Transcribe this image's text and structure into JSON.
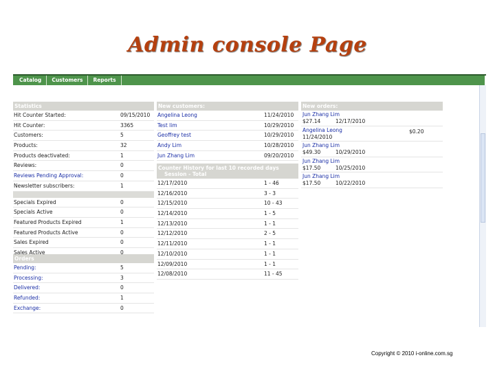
{
  "title": "Admin console Page",
  "copyright": "Copyright © 2010  i-online.com.sg",
  "nav": [
    "Catalog",
    "Customers",
    "Reports"
  ],
  "statistics": {
    "header": "Statistics",
    "rows": [
      {
        "label": "Hit Counter Started:",
        "value": "09/15/2010",
        "link": false
      },
      {
        "label": "Hit Counter:",
        "value": "3365",
        "link": false
      },
      {
        "label": "Customers:",
        "value": "5",
        "link": false
      },
      {
        "label": "Products:",
        "value": "32",
        "link": false
      },
      {
        "label": "Products deactivated:",
        "value": "1",
        "link": false
      },
      {
        "label": "Reviews:",
        "value": "0",
        "link": false
      },
      {
        "label": "Reviews Pending Approval:",
        "value": "0",
        "link": true
      },
      {
        "label": "Newsletter subscribers:",
        "value": "1",
        "link": false
      }
    ],
    "specials": [
      {
        "label": "Specials Expired",
        "value": "0"
      },
      {
        "label": "Specials Active",
        "value": "0"
      },
      {
        "label": "Featured Products Expired",
        "value": "1"
      },
      {
        "label": "Featured Products Active",
        "value": "0"
      },
      {
        "label": "Sales Expired",
        "value": "0"
      },
      {
        "label": "Sales Active",
        "value": "0"
      }
    ]
  },
  "orders": {
    "header": "Orders",
    "rows": [
      {
        "label": "Pending:",
        "value": "5"
      },
      {
        "label": "Processing:",
        "value": "3"
      },
      {
        "label": "Delivered:",
        "value": "0"
      },
      {
        "label": "Refunded:",
        "value": "1"
      },
      {
        "label": "Exchange:",
        "value": "0"
      }
    ]
  },
  "new_customers": {
    "header": "New customers:",
    "rows": [
      {
        "name": "Angelina Leong",
        "date": "11/24/2010"
      },
      {
        "name": "Test lim",
        "date": "10/29/2010"
      },
      {
        "name": "Geoffrey test",
        "date": "10/29/2010"
      },
      {
        "name": "Andy Lim",
        "date": "10/28/2010"
      },
      {
        "name": "Jun Zhang Lim",
        "date": "09/20/2010"
      }
    ]
  },
  "counter_history": {
    "header_line1": "Counter History for last 10 recorded days",
    "header_line2": "Session - Total",
    "rows": [
      {
        "date": "12/17/2010",
        "value": "1 - 46"
      },
      {
        "date": "12/16/2010",
        "value": "3 - 3"
      },
      {
        "date": "12/15/2010",
        "value": "10 - 43"
      },
      {
        "date": "12/14/2010",
        "value": "1 - 5"
      },
      {
        "date": "12/13/2010",
        "value": "1 - 1"
      },
      {
        "date": "12/12/2010",
        "value": "2 - 5"
      },
      {
        "date": "12/11/2010",
        "value": "1 - 1"
      },
      {
        "date": "12/10/2010",
        "value": "1 - 1"
      },
      {
        "date": "12/09/2010",
        "value": "1 - 1"
      },
      {
        "date": "12/08/2010",
        "value": "11 - 45"
      }
    ]
  },
  "new_orders": {
    "header": "New orders:",
    "rows": [
      {
        "name": "Jun Zhang Lim",
        "amount": "$27.14",
        "date": "12/17/2010",
        "alt": false
      },
      {
        "name": "Angelina Leong",
        "amount": "$0.20",
        "date": "11/24/2010",
        "alt": true
      },
      {
        "name": "Jun Zhang Lim",
        "amount": "$49.30",
        "date": "10/29/2010",
        "alt": false
      },
      {
        "name": "Jun Zhang Lim",
        "amount": "$17.50",
        "date": "10/25/2010",
        "alt": false
      },
      {
        "name": "Jun Zhang Lim",
        "amount": "$17.50",
        "date": "10/22/2010",
        "alt": false
      }
    ]
  }
}
